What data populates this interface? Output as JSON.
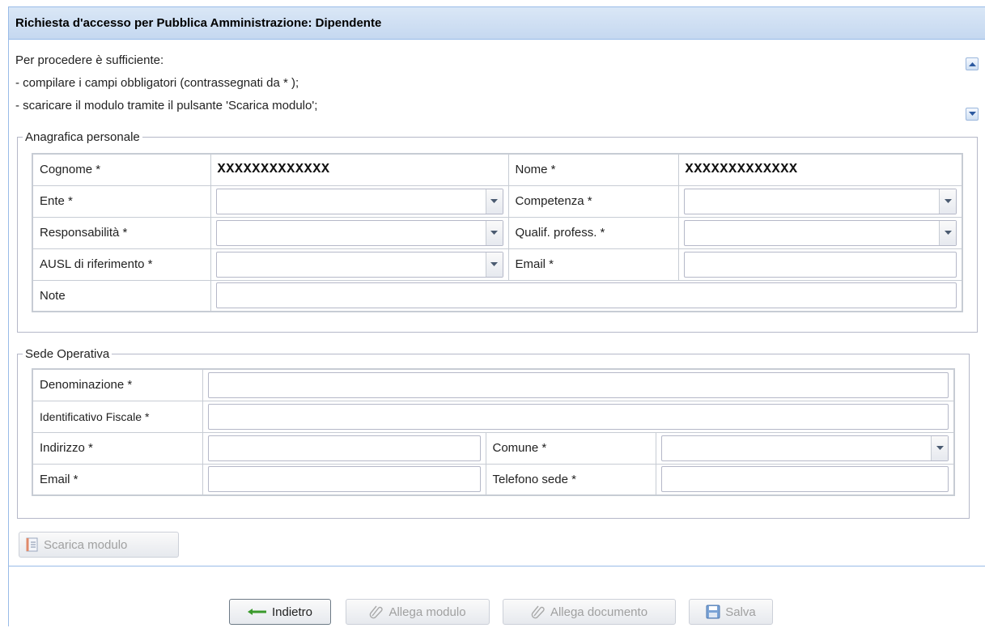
{
  "panel": {
    "title": "Richiesta d'accesso per Pubblica Amministrazione: Dipendente"
  },
  "intro": {
    "lines": [
      "Per procedere è sufficiente:",
      "- compilare i campi obbligatori (contrassegnati da * );",
      "- scaricare il modulo tramite il pulsante 'Scarica modulo';"
    ]
  },
  "anagrafica": {
    "legend": "Anagrafica personale",
    "cognome_label": "Cognome *",
    "cognome_value": "XXXXXXXXXXXXX",
    "nome_label": "Nome *",
    "nome_value": "XXXXXXXXXXXXX",
    "ente_label": "Ente *",
    "competenza_label": "Competenza *",
    "responsabilita_label": "Responsabilità *",
    "qualif_label": "Qualif. profess. *",
    "ausl_label": "AUSL di riferimento *",
    "email_label": "Email *",
    "note_label": "Note"
  },
  "sede": {
    "legend": "Sede Operativa",
    "denominazione_label": "Denominazione *",
    "idfiscale_label": "Identificativo Fiscale *",
    "indirizzo_label": "Indirizzo *",
    "comune_label": "Comune *",
    "email_label": "Email *",
    "telefono_label": "Telefono sede *"
  },
  "buttons": {
    "scarica": "Scarica modulo",
    "indietro": "Indietro",
    "allega_modulo": "Allega modulo",
    "allega_documento": "Allega documento",
    "salva": "Salva"
  },
  "icons": {
    "scroll_up": "chevron-up-icon",
    "scroll_down": "chevron-down-icon",
    "dropdown": "chevron-down-icon",
    "scarica": "document-icon",
    "indietro": "arrow-left-icon",
    "allega": "paperclip-icon",
    "salva": "floppy-disk-icon"
  },
  "colors": {
    "header_text": "#15428b",
    "panel_border": "#99bbe8",
    "arrow_green": "#3a9a2c"
  }
}
